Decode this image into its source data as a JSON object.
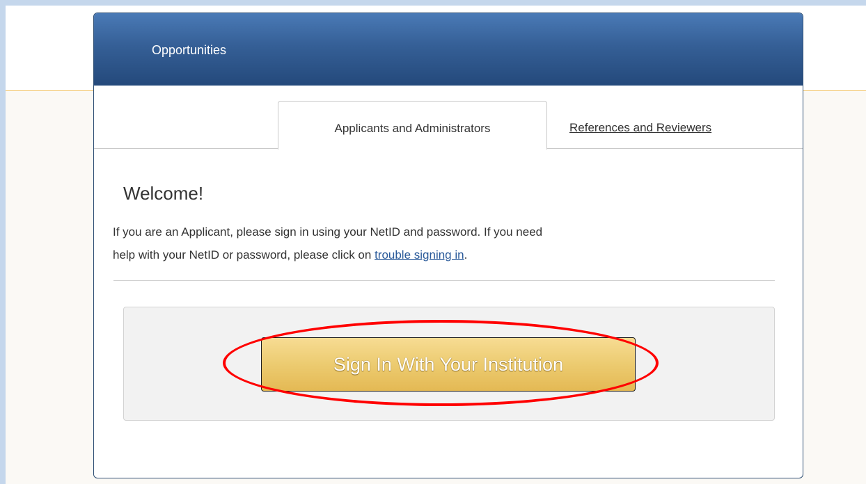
{
  "header": {
    "title": "Opportunities"
  },
  "tabs": [
    {
      "label": "Applicants and Administrators",
      "active": true
    },
    {
      "label": "References and Reviewers",
      "active": false
    }
  ],
  "main": {
    "heading": "Welcome!",
    "intro_line1": "If you are an Applicant, please sign in using your NetID and password. If you need",
    "intro_line2_prefix": "help with your NetID or password, please click on ",
    "trouble_link": "trouble signing in",
    "intro_line2_suffix": ".",
    "signin_button_label": "Sign In With Your Institution"
  },
  "colors": {
    "header_blue": "#355f96",
    "button_gold": "#eccb70",
    "highlight_red": "#ff0000",
    "link_blue": "#2a5a9a"
  }
}
